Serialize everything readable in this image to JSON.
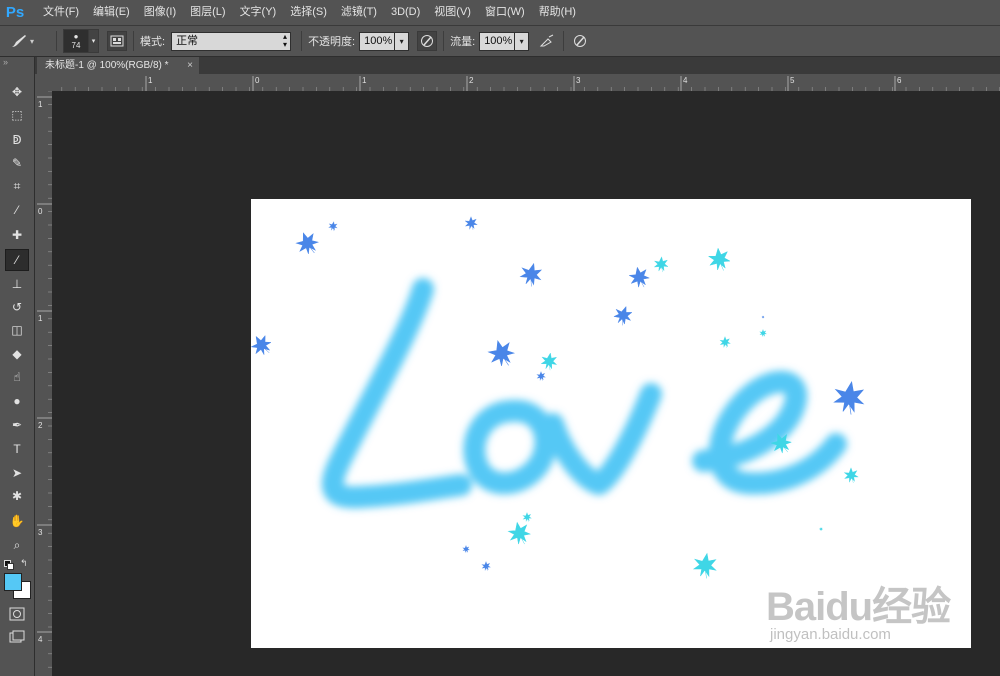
{
  "app": {
    "logo": "Ps"
  },
  "menu": [
    "文件(F)",
    "编辑(E)",
    "图像(I)",
    "图层(L)",
    "文字(Y)",
    "选择(S)",
    "滤镜(T)",
    "3D(D)",
    "视图(V)",
    "窗口(W)",
    "帮助(H)"
  ],
  "options": {
    "brush_size": "74",
    "mode_label": "模式:",
    "mode_value": "正常",
    "opacity_label": "不透明度:",
    "opacity_value": "100%",
    "flow_label": "流量:",
    "flow_value": "100%"
  },
  "document": {
    "tab_title": "未标题-1 @ 100%(RGB/8) *",
    "close_glyph": "×"
  },
  "rulers": {
    "top_labels": [
      "1",
      "0",
      "1",
      "2",
      "3",
      "4",
      "5",
      "6"
    ],
    "left_labels": [
      "1",
      "0",
      "1",
      "2",
      "3",
      "4"
    ]
  },
  "artwork": {
    "text": "Love",
    "stroke_color": "#55c8f5"
  },
  "colors": {
    "foreground": "#55c8f5",
    "background": "#ffffff",
    "leaf_blue": "#4a86e8",
    "leaf_cyan": "#3fd6e6"
  },
  "tools": [
    "move-tool",
    "marquee-tool",
    "lasso-tool",
    "quick-select-tool",
    "crop-tool",
    "eyedropper-tool",
    "healing-brush-tool",
    "brush-tool",
    "clone-stamp-tool",
    "history-brush-tool",
    "eraser-tool",
    "paint-bucket-tool",
    "smudge-tool",
    "dodge-tool",
    "pen-tool",
    "type-tool",
    "path-select-tool",
    "shape-tool",
    "hand-tool",
    "zoom-tool"
  ],
  "watermark": {
    "logo": "Baidu经验",
    "url": "jingyan.baidu.com"
  }
}
